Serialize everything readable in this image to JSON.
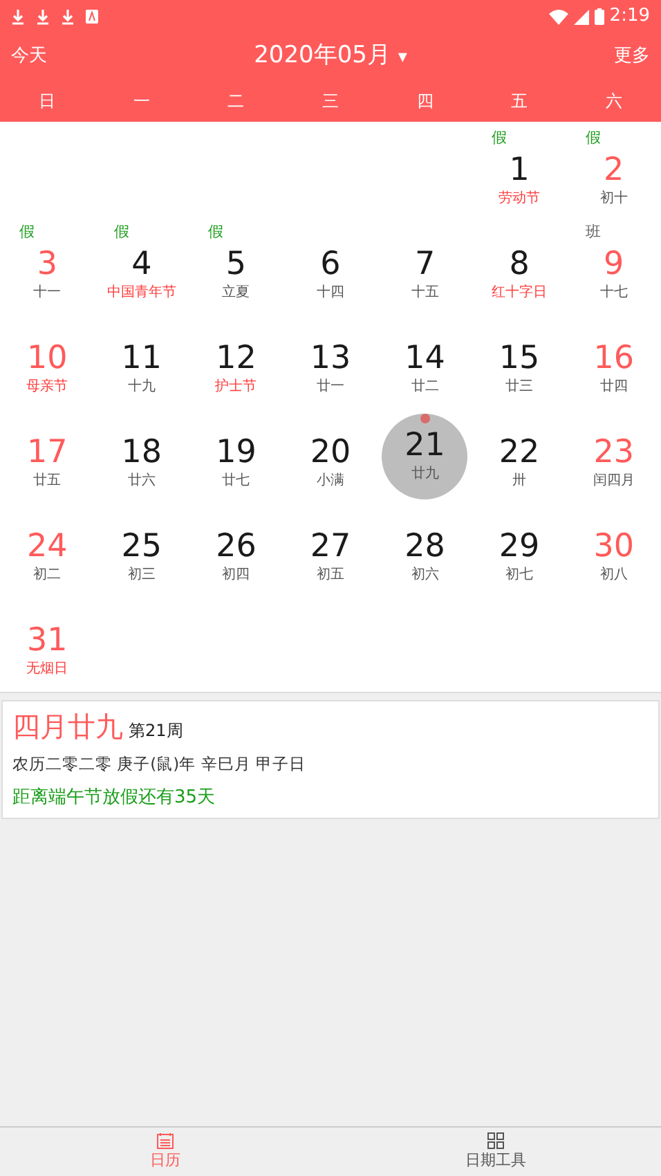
{
  "status_bar": {
    "time": "2:19"
  },
  "header": {
    "left": "今天",
    "title": "2020年05月",
    "caret": "▾",
    "right": "更多"
  },
  "weekdays": [
    "日",
    "一",
    "二",
    "三",
    "四",
    "五",
    "六"
  ],
  "weeks": [
    {
      "kind": "first",
      "days": [
        {
          "day": "1",
          "lunar": "劳动节",
          "red": false,
          "festival": true,
          "tag": {
            "text": "假",
            "kind": "off"
          },
          "selected": false,
          "marked": false
        },
        {
          "day": "2",
          "lunar": "初十",
          "red": true,
          "festival": false,
          "tag": {
            "text": "假",
            "kind": "off"
          },
          "selected": false,
          "marked": false
        }
      ]
    },
    {
      "days": [
        {
          "day": "3",
          "lunar": "十一",
          "red": true,
          "festival": false,
          "tag": {
            "text": "假",
            "kind": "off"
          },
          "selected": false,
          "marked": false
        },
        {
          "day": "4",
          "lunar": "中国青年节",
          "red": false,
          "festival": true,
          "tag": {
            "text": "假",
            "kind": "off"
          },
          "selected": false,
          "marked": false
        },
        {
          "day": "5",
          "lunar": "立夏",
          "red": false,
          "festival": false,
          "tag": {
            "text": "假",
            "kind": "off"
          },
          "selected": false,
          "marked": false
        },
        {
          "day": "6",
          "lunar": "十四",
          "red": false,
          "festival": false,
          "selected": false,
          "marked": false
        },
        {
          "day": "7",
          "lunar": "十五",
          "red": false,
          "festival": false,
          "selected": false,
          "marked": false
        },
        {
          "day": "8",
          "lunar": "红十字日",
          "red": false,
          "festival": true,
          "selected": false,
          "marked": false
        },
        {
          "day": "9",
          "lunar": "十七",
          "red": true,
          "festival": false,
          "tag": {
            "text": "班",
            "kind": "work"
          },
          "selected": false,
          "marked": false
        }
      ]
    },
    {
      "days": [
        {
          "day": "10",
          "lunar": "母亲节",
          "red": true,
          "festival": true,
          "selected": false,
          "marked": false
        },
        {
          "day": "11",
          "lunar": "十九",
          "red": false,
          "festival": false,
          "selected": false,
          "marked": false
        },
        {
          "day": "12",
          "lunar": "护士节",
          "red": false,
          "festival": true,
          "selected": false,
          "marked": false
        },
        {
          "day": "13",
          "lunar": "廿一",
          "red": false,
          "festival": false,
          "selected": false,
          "marked": false
        },
        {
          "day": "14",
          "lunar": "廿二",
          "red": false,
          "festival": false,
          "selected": false,
          "marked": false
        },
        {
          "day": "15",
          "lunar": "廿三",
          "red": false,
          "festival": false,
          "selected": false,
          "marked": false
        },
        {
          "day": "16",
          "lunar": "廿四",
          "red": true,
          "festival": false,
          "selected": false,
          "marked": false
        }
      ]
    },
    {
      "days": [
        {
          "day": "17",
          "lunar": "廿五",
          "red": true,
          "festival": false,
          "selected": false,
          "marked": false
        },
        {
          "day": "18",
          "lunar": "廿六",
          "red": false,
          "festival": false,
          "selected": false,
          "marked": false
        },
        {
          "day": "19",
          "lunar": "廿七",
          "red": false,
          "festival": false,
          "selected": false,
          "marked": false
        },
        {
          "day": "20",
          "lunar": "小满",
          "red": false,
          "festival": false,
          "selected": false,
          "marked": false
        },
        {
          "day": "21",
          "lunar": "廿九",
          "red": false,
          "festival": false,
          "selected": true,
          "marked": true
        },
        {
          "day": "22",
          "lunar": "卅",
          "red": false,
          "festival": false,
          "selected": false,
          "marked": false
        },
        {
          "day": "23",
          "lunar": "闰四月",
          "red": true,
          "festival": false,
          "selected": false,
          "marked": false
        }
      ]
    },
    {
      "days": [
        {
          "day": "24",
          "lunar": "初二",
          "red": true,
          "festival": false,
          "selected": false,
          "marked": false
        },
        {
          "day": "25",
          "lunar": "初三",
          "red": false,
          "festival": false,
          "selected": false,
          "marked": false
        },
        {
          "day": "26",
          "lunar": "初四",
          "red": false,
          "festival": false,
          "selected": false,
          "marked": false
        },
        {
          "day": "27",
          "lunar": "初五",
          "red": false,
          "festival": false,
          "selected": false,
          "marked": false
        },
        {
          "day": "28",
          "lunar": "初六",
          "red": false,
          "festival": false,
          "selected": false,
          "marked": false
        },
        {
          "day": "29",
          "lunar": "初七",
          "red": false,
          "festival": false,
          "selected": false,
          "marked": false
        },
        {
          "day": "30",
          "lunar": "初八",
          "red": true,
          "festival": false,
          "selected": false,
          "marked": false
        }
      ]
    },
    {
      "kind": "last",
      "days": [
        {
          "day": "31",
          "lunar": "无烟日",
          "red": true,
          "festival": true,
          "selected": false,
          "marked": false
        }
      ]
    }
  ],
  "info": {
    "lunar_date": "四月廿九",
    "week": "第21周",
    "ganzhi": "农历二零二零 庚子(鼠)年 辛巳月 甲子日",
    "countdown": "距离端午节放假还有35天"
  },
  "bottom_nav": [
    {
      "label": "日历",
      "selected": true
    },
    {
      "label": "日期工具",
      "selected": false
    }
  ]
}
